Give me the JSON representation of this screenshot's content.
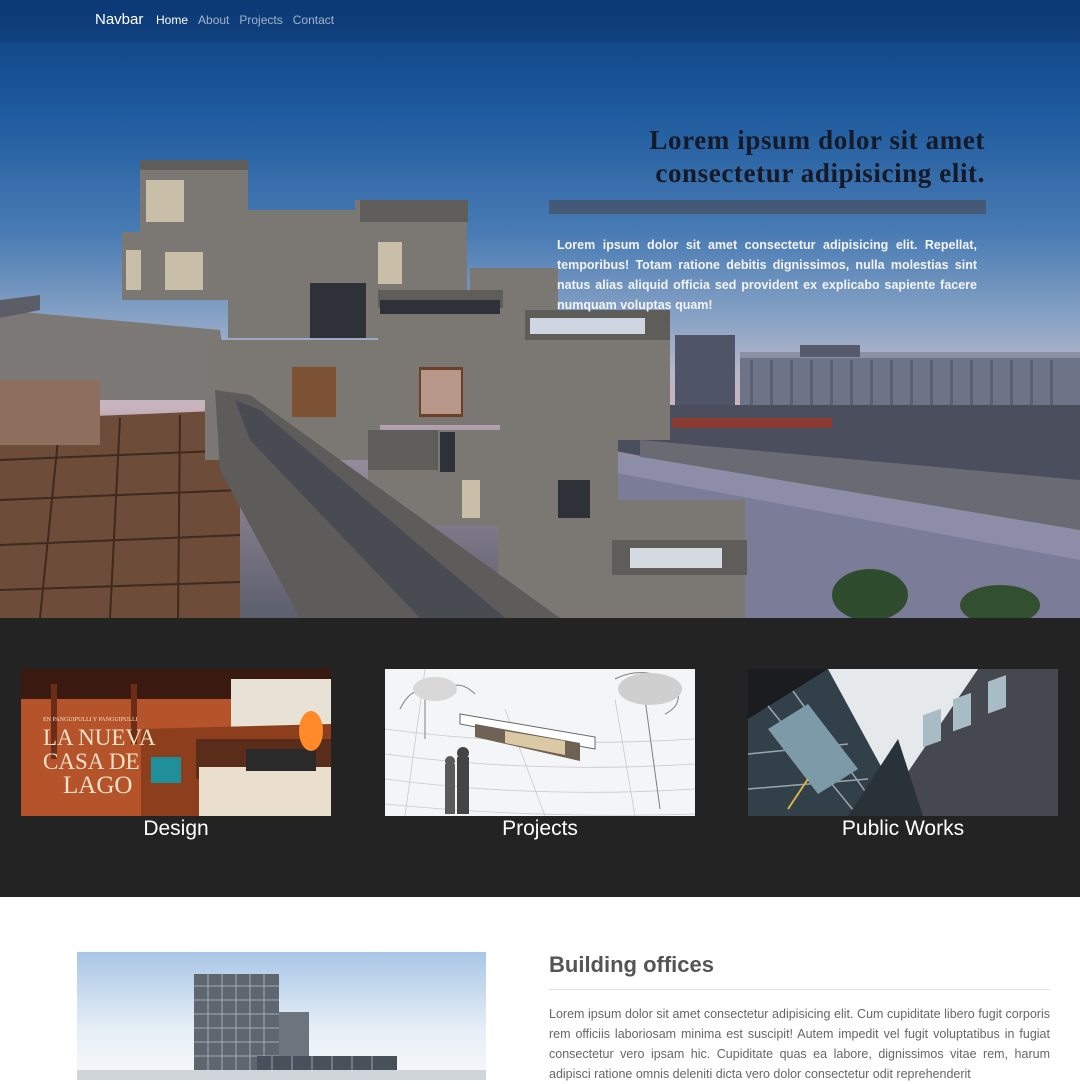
{
  "navbar": {
    "brand": "Navbar",
    "links": [
      "Home",
      "About",
      "Projects",
      "Contact"
    ]
  },
  "hero": {
    "heading_line1": "Lorem ipsum dolor sit amet",
    "heading_line2": "consectetur adipisicing elit.",
    "body": "Lorem ipsum dolor sit amet consectetur adipisicing elit. Repellat, temporibus! Totam ratione debitis dignissimos, nulla molestias sint natus alias aliquid officia sed provident ex explicabo sapiente facere numquam voluptas quam!"
  },
  "categories": [
    {
      "label": "Design",
      "image_lines": [
        "EN PANGUIPULLI Y PANGUIPULLI",
        "LA NUEVA",
        "CASA DE",
        "LAGO"
      ]
    },
    {
      "label": "Projects"
    },
    {
      "label": "Public Works"
    }
  ],
  "section": {
    "title": "Building offices",
    "body": "Lorem ipsum dolor sit amet consectetur adipisicing elit. Cum cupiditate libero fugit corporis rem officiis laboriosam minima est suscipit! Autem impedit vel fugit voluptatibus in fugiat consectetur vero ipsam hic. Cupiditate quas ea labore, dignissimos vitae rem, harum adipisci ratione omnis deleniti dicta vero dolor consectetur odit reprehenderit"
  }
}
